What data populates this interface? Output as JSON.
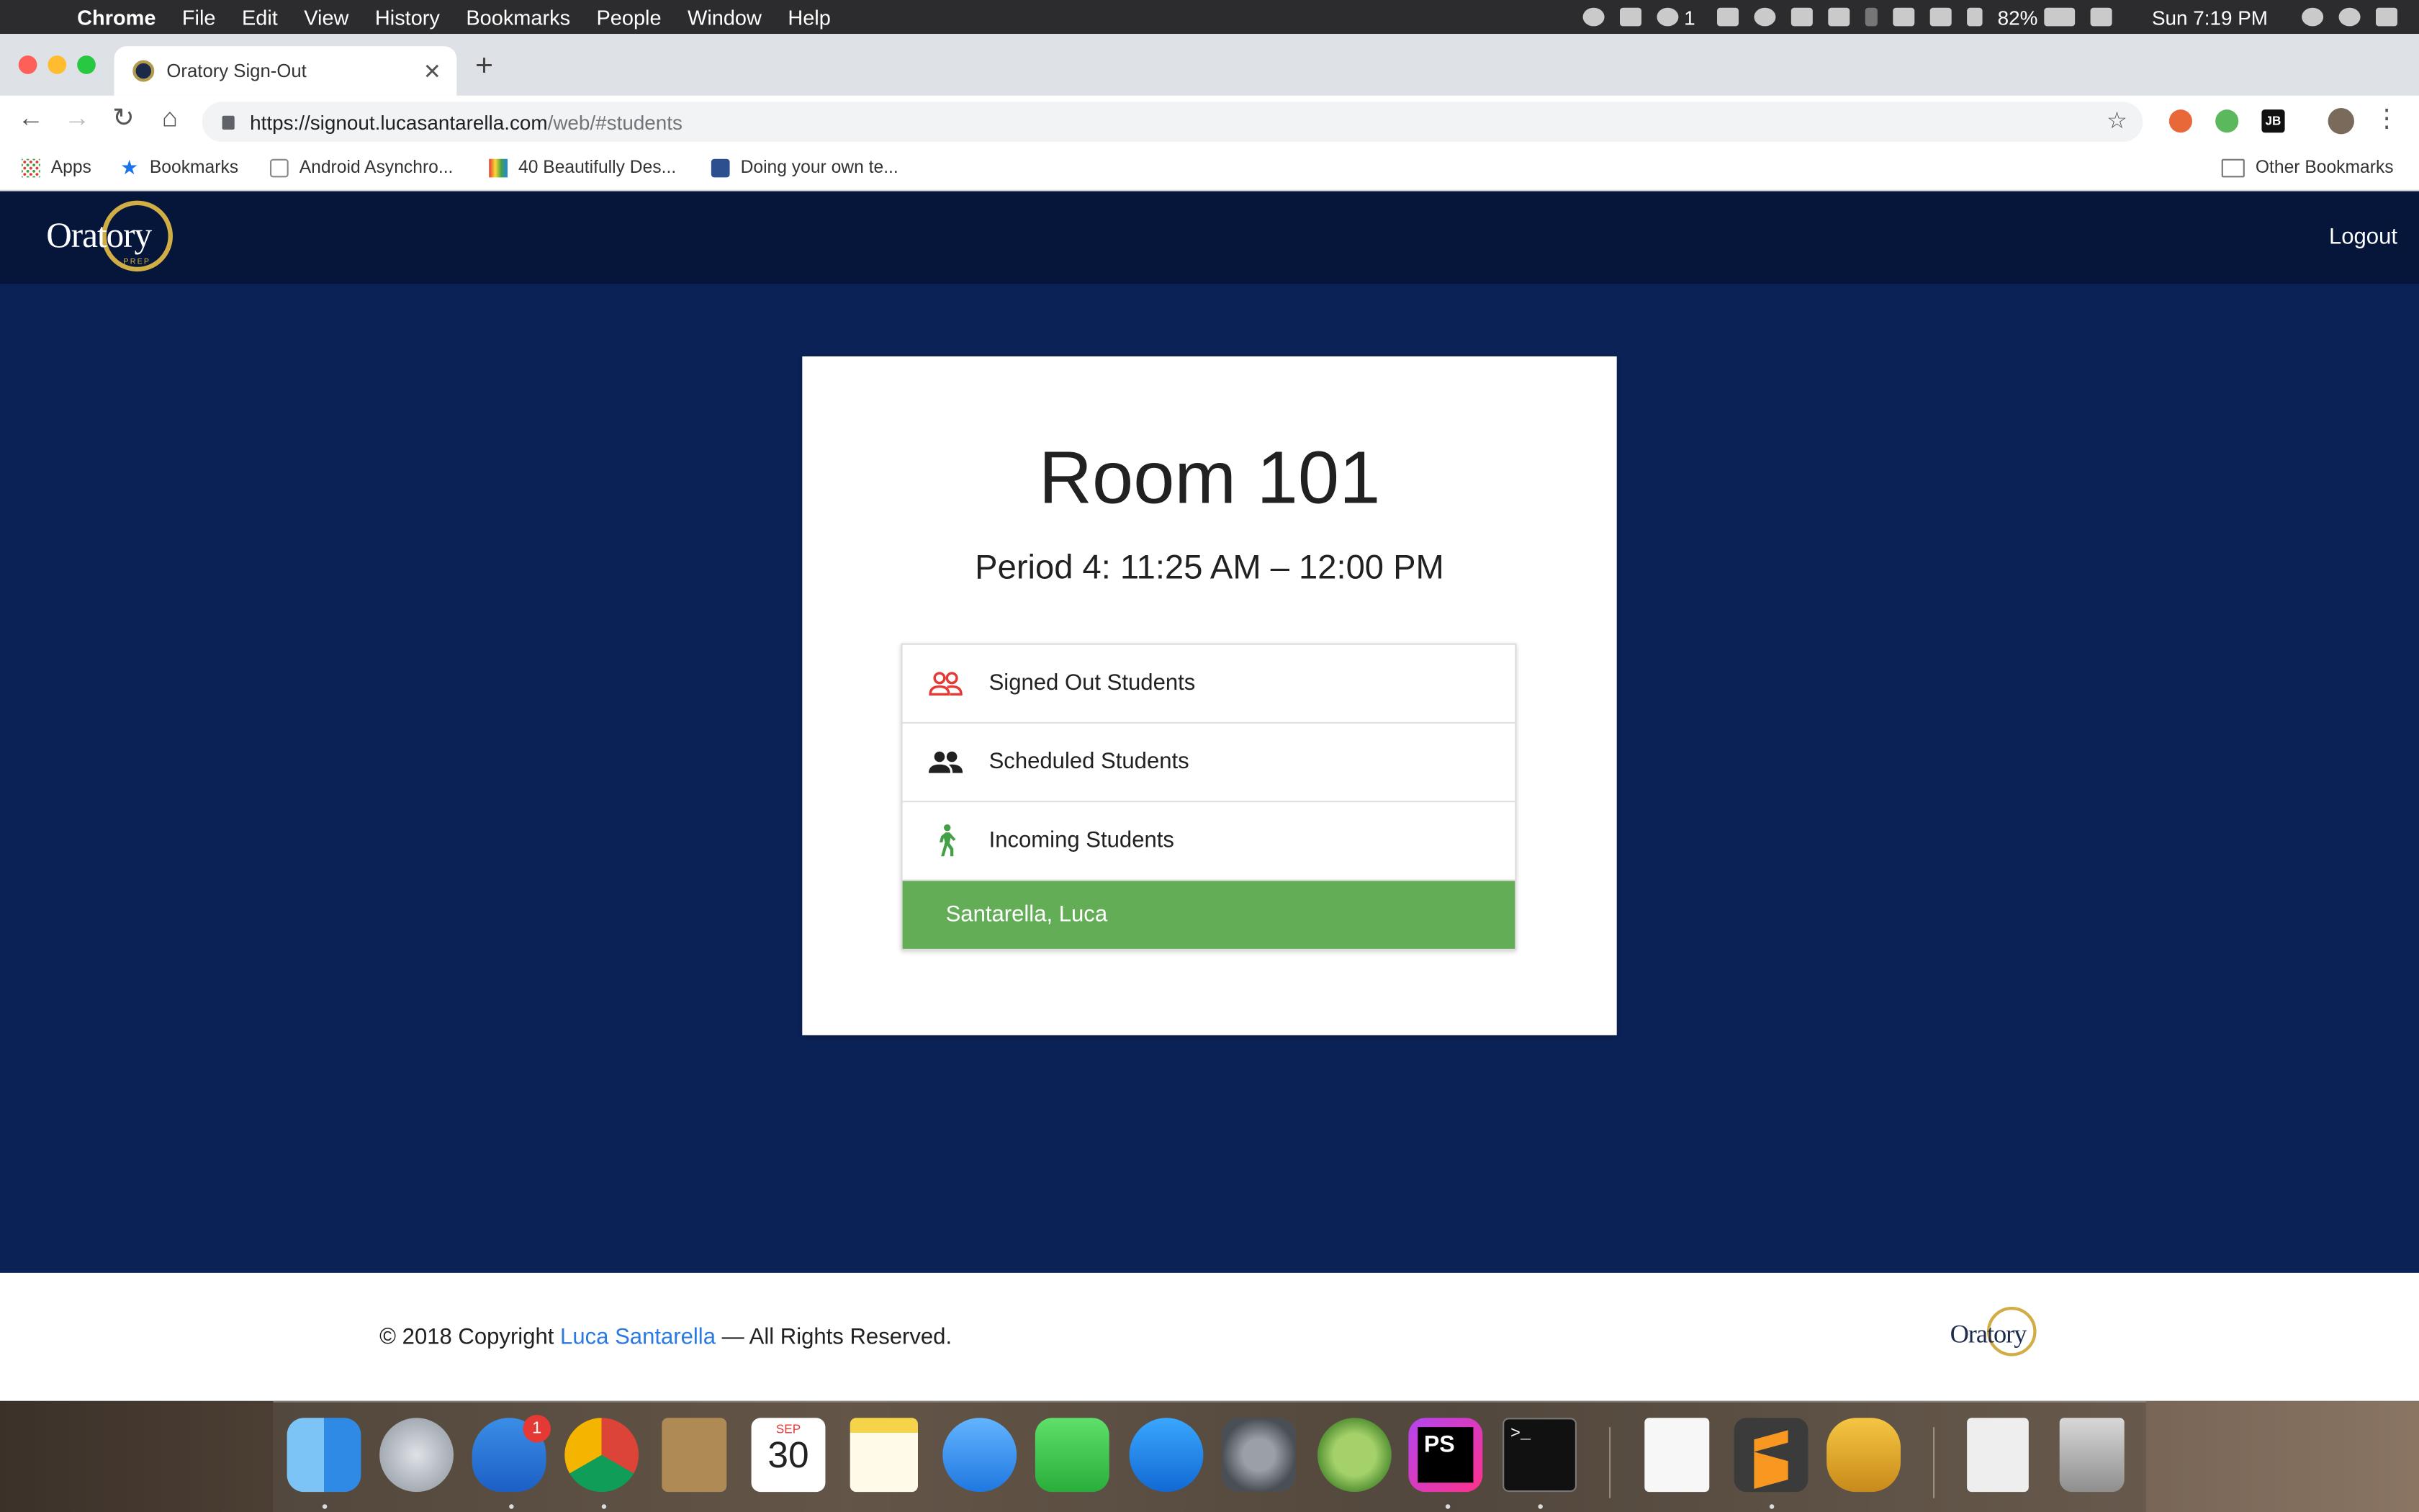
{
  "menubar": {
    "app": "Chrome",
    "items": [
      "File",
      "Edit",
      "View",
      "History",
      "Bookmarks",
      "People",
      "Window",
      "Help"
    ],
    "status": {
      "notifications": "1",
      "battery": "82%",
      "clock": "Sun 7:19 PM"
    }
  },
  "browser": {
    "tab_title": "Oratory Sign-Out",
    "url_domain": "https://signout.lucasantarella.com",
    "url_path": "/web/#students",
    "bookmarks": [
      "Apps",
      "Bookmarks",
      "Android Asynchro...",
      "40 Beautifully Des...",
      "Doing your own te..."
    ],
    "other_bookmarks": "Other Bookmarks",
    "ext_label": "JB"
  },
  "nav": {
    "logo_text": "Oratory",
    "logo_sub": "PREP",
    "logout": "Logout"
  },
  "card": {
    "room": "Room 101",
    "period": "Period 4: 11:25 AM – 12:00 PM",
    "list": [
      {
        "label": "Signed Out Students",
        "icon": "people-outline-icon",
        "color": "#e53935"
      },
      {
        "label": "Scheduled Students",
        "icon": "people-icon",
        "color": "#212121"
      },
      {
        "label": "Incoming Students",
        "icon": "walk-icon",
        "color": "#43a047"
      }
    ],
    "student": "Santarella, Luca"
  },
  "footer": {
    "prefix": "© 2018 Copyright ",
    "author": "Luca Santarella",
    "suffix": " — All Rights Reserved.",
    "logo_text": "Oratory"
  },
  "dock": {
    "calendar_month": "SEP",
    "calendar_day": "30",
    "badge": "1",
    "phpstorm": "PS",
    "terminal": ">_"
  },
  "colors": {
    "page_bg": "#0b2257",
    "navbar": "#05163a",
    "accent_gold": "#d1ad45",
    "student_green": "#63ad57",
    "link_blue": "#2a7ae2"
  }
}
